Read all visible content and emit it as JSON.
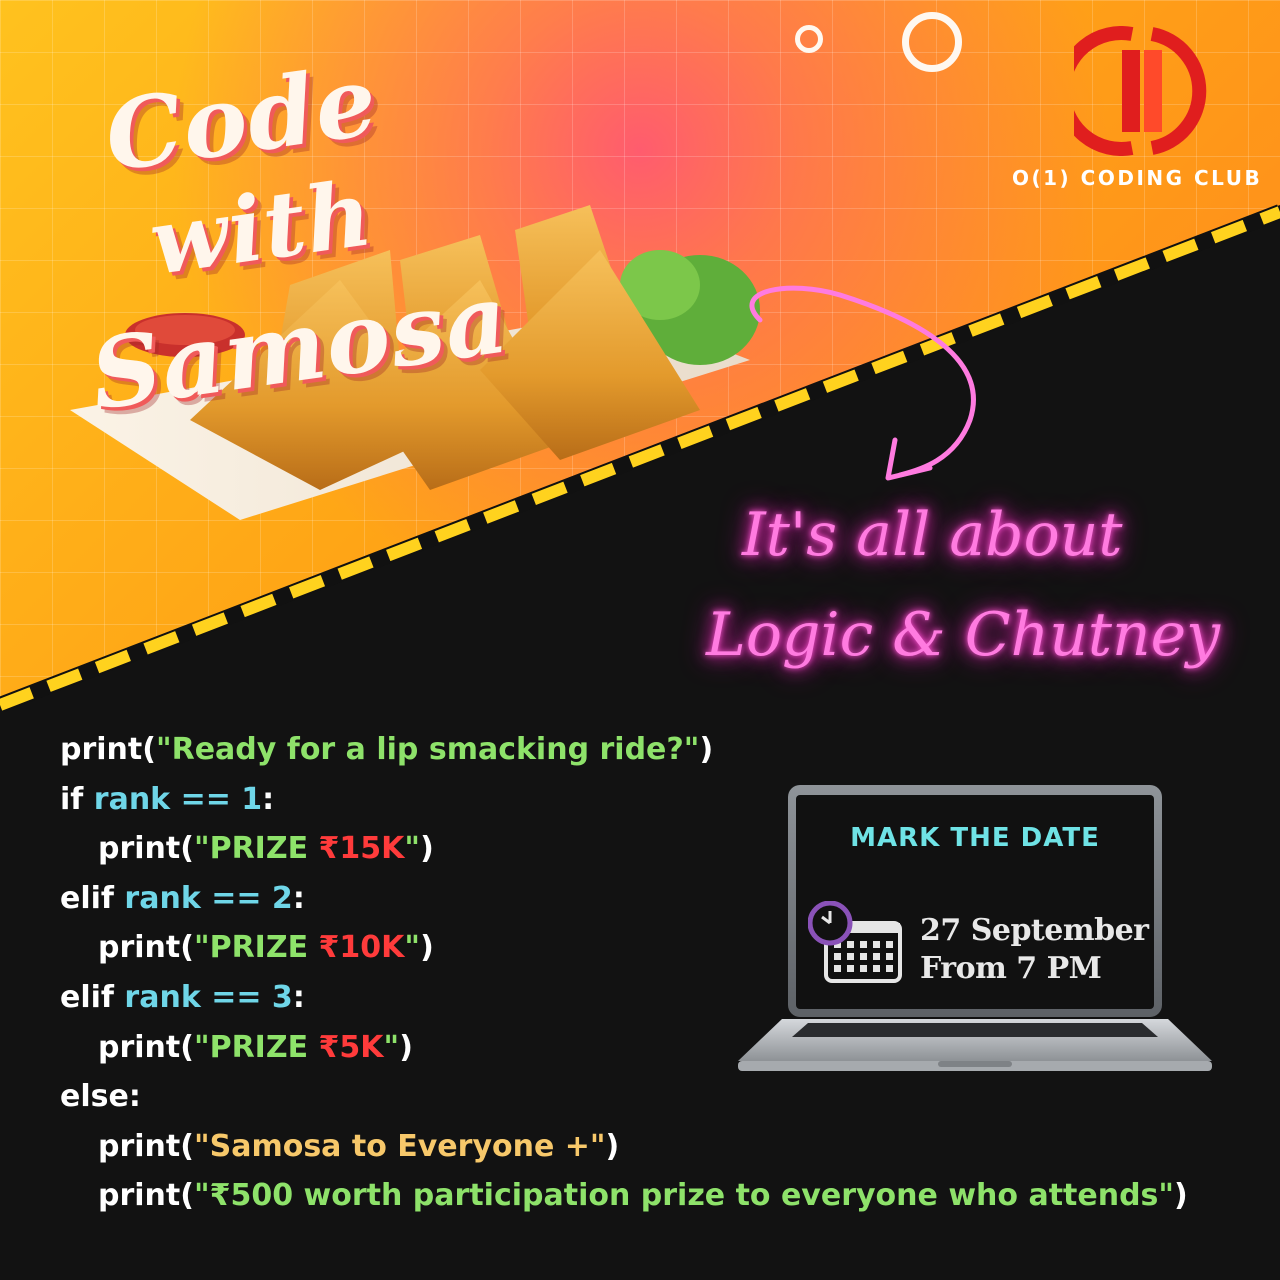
{
  "title": {
    "line1": "Code",
    "line2": "with",
    "line3": "Samosa"
  },
  "club": {
    "name": "O(1) CODING CLUB",
    "logo_icon": "o1-logo-icon"
  },
  "tagline": {
    "line1": "It's all about",
    "line2": "Logic & Chutney"
  },
  "colors": {
    "orange": "#ffa516",
    "pink_neon": "#ff7be0",
    "stripe_yellow": "#ffd21e",
    "code_green": "#8ee26a",
    "code_cyan": "#6fd6e8",
    "code_red": "#ff3b3b",
    "code_yellow": "#f7c86a",
    "screen_cyan": "#6fe3e6"
  },
  "code": {
    "l1": {
      "kw": "print(",
      "str": "\"Ready for a lip smacking ride?\"",
      "end": ")"
    },
    "l2": {
      "kw": "if ",
      "var": "rank == 1",
      "end": ":"
    },
    "l3": {
      "kw": "print(",
      "str": "\"PRIZE ",
      "prize": "₹15K",
      "str2": "\"",
      "end": ")"
    },
    "l4": {
      "kw": "elif ",
      "var": "rank == 2",
      "end": ":"
    },
    "l5": {
      "kw": "print(",
      "str": "\"PRIZE ",
      "prize": "₹10K",
      "str2": "\"",
      "end": ")"
    },
    "l6": {
      "kw": "elif ",
      "var": "rank == 3",
      "end": ":"
    },
    "l7": {
      "kw": "print(",
      "str": "\"PRIZE ",
      "prize": "₹5K",
      "str2": "\"",
      "end": ")"
    },
    "l8": {
      "kw": "else:"
    },
    "l9": {
      "kw": "print(",
      "str": "\"Samosa to Everyone +\"",
      "end": ")"
    },
    "l10": {
      "kw": "print(",
      "str": "\"₹500 worth participation prize to everyone who attends\"",
      "end": ")"
    }
  },
  "event": {
    "heading": "MARK THE DATE",
    "date": "27 September",
    "time": "From 7 PM",
    "icon": "calendar-clock-icon"
  }
}
